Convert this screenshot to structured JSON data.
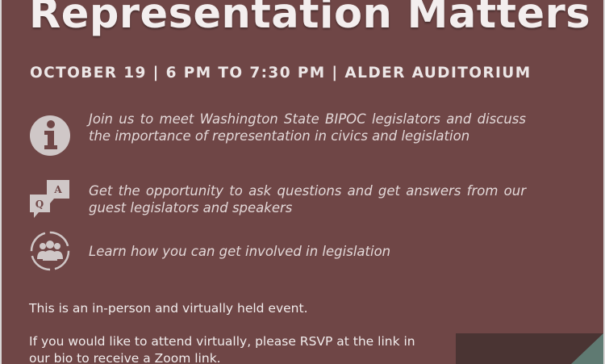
{
  "title": "Representation Matters",
  "subtitle": "OCTOBER 19 | 6 PM TO 7:30 PM | ALDER AUDITORIUM",
  "items": [
    {
      "icon": "info-icon",
      "text": "Join us to meet Washington State BIPOC legislators and discuss the importance of representation in civics and legislation"
    },
    {
      "icon": "question-answer-icon",
      "text": "Get the opportunity to ask questions and get answers from our guest legislators and speakers"
    },
    {
      "icon": "community-group-icon",
      "text": "Learn how you can get involved in legislation"
    }
  ],
  "qa_icon_letters": {
    "q": "Q",
    "a": "A"
  },
  "note_1": "This is an in-person and virtually held event.",
  "note_2": "If you would like to attend virtually, please RSVP at the link in our bio to receive a Zoom link.",
  "colors": {
    "background": "#6f4646",
    "text": "#f1ecec",
    "icon": "#cfc7c7",
    "corner_dark": "#4a3433",
    "corner_teal": "#5f7a72"
  }
}
